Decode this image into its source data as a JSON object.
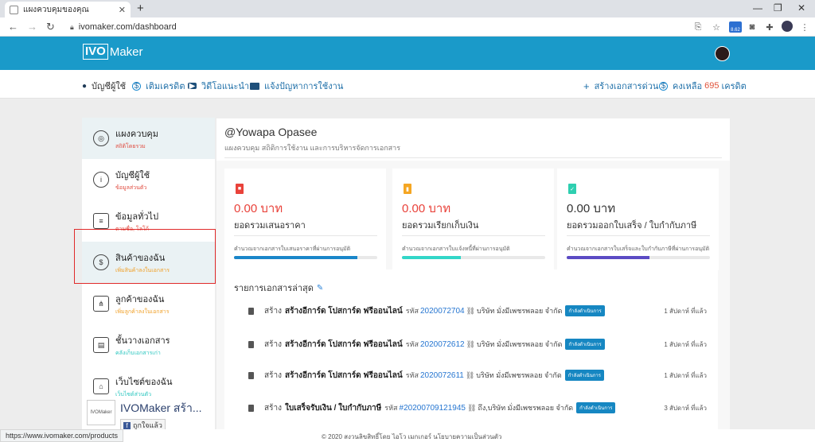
{
  "browser": {
    "tab_title": "แผงควบคุมของคุณ",
    "tab_close": "✕",
    "new_tab": "+",
    "url": "ivomaker.com/dashboard",
    "ext_badge": "8.62",
    "status_url": "https://www.ivomaker.com/products"
  },
  "header": {
    "logo_box": "IVO",
    "logo_text": "Maker"
  },
  "subnav": {
    "account": "บัญชีผู้ใช้",
    "topup": "เติมเครดิต",
    "videos": "วิดีโอแนะนำ",
    "report": "แจ้งปัญหาการใช้งาน",
    "quick_create": "สร้างเอกสารด่วน",
    "credit_prefix": "คงเหลือ",
    "credit_value": "695",
    "credit_suffix": "เครดิต"
  },
  "sidebar": {
    "items": [
      {
        "label": "แผงควบคุม",
        "sub": "สถิติโดยรวม"
      },
      {
        "label": "บัญชีผู้ใช้",
        "sub": "ข้อมูลส่วนตัว"
      },
      {
        "label": "ข้อมูลทั่วไป",
        "sub": "ตามชื่อ, โลโก้"
      },
      {
        "label": "สินค้าของฉัน",
        "sub": "เพิ่มสินค้าลงในเอกสาร"
      },
      {
        "label": "ลูกค้าของฉัน",
        "sub": "เพิ่มลูกค้าลงในเอกสาร"
      },
      {
        "label": "ชั้นวางเอกสาร",
        "sub": "คลังเก็บเอกสารเก่า"
      },
      {
        "label": "เว็บไซต์ของฉัน",
        "sub": "เว็บไซต์ส่วนตัว"
      }
    ],
    "fb_logo": "IVOMaker",
    "fb_title": "IVOMaker สร้า...",
    "fb_like": "ถูกใจแล้ว"
  },
  "main": {
    "username": "@Yowapa Opasee",
    "description": "แผงควบคุม สถิติการใช้งาน และการบริหารจัดการเอกสาร",
    "cards": [
      {
        "amount": "0.00 บาท",
        "label": "ยอดรวมเสนอราคา",
        "note": "คำนวณจากเอกสารใบเสนอราคาที่ผ่านการอนุมัติ",
        "progress": 0.86
      },
      {
        "amount": "0.00 บาท",
        "label": "ยอดรวมเรียกเก็บเงิน",
        "note": "คำนวณจากเอกสารใบแจ้งหนี้ที่ผ่านการอนุมัติ",
        "progress": 0.41
      },
      {
        "amount": "0.00 บาท",
        "label": "ยอดรวมออกใบเสร็จ / ใบกำกับภาษี",
        "note": "คำนวณจากเอกสารใบเสร็จและใบกำกับภาษีที่ผ่านการอนุมัติ",
        "progress": 0.58
      }
    ],
    "recent_title": "รายการเอกสารล่าสุด",
    "recent": [
      {
        "prefix": "สร้าง",
        "title": "สร้างอีการ์ด โปสการ์ด ฟรีออนไลน์",
        "code_label": "รหัส",
        "code": "2020072704",
        "company": "บริษัท มั่งมีเพชรพลอย จำกัด",
        "badge": "กำลังดำเนินการ",
        "time": "1 สัปดาห์ ที่แล้ว"
      },
      {
        "prefix": "สร้าง",
        "title": "สร้างอีการ์ด โปสการ์ด ฟรีออนไลน์",
        "code_label": "รหัส",
        "code": "2020072612",
        "company": "บริษัท มั่งมีเพชรพลอย จำกัด",
        "badge": "กำลังดำเนินการ",
        "time": "1 สัปดาห์ ที่แล้ว"
      },
      {
        "prefix": "สร้าง",
        "title": "สร้างอีการ์ด โปสการ์ด ฟรีออนไลน์",
        "code_label": "รหัส",
        "code": "2020072611",
        "company": "บริษัท มั่งมีเพชรพลอย จำกัด",
        "badge": "กำลังดำเนินการ",
        "time": "1 สัปดาห์ ที่แล้ว"
      },
      {
        "prefix": "สร้าง",
        "title": "ใบเสร็จรับเงิน / ใบกำกับภาษี",
        "code_label": "รหัส",
        "code": "#20200709121945",
        "company": "ถึง,บริษัท มั่งมีเพชรพลอย จำกัด",
        "badge": "กำลังดำเนินการ",
        "time": "3 สัปดาห์ ที่แล้ว"
      }
    ]
  },
  "footer": "© 2020 สงวนลิขสิทธิ์โดย ไอโว เมกเกอร์ นโยบายความเป็นส่วนตัว",
  "colors": {
    "brand": "#1a9ac9",
    "card1": "#e9423a",
    "card2": "#f5a623",
    "card3": "#2ecfb0",
    "bar1": "#1a86c9",
    "bar2": "#32d6c8",
    "bar3": "#5b4bc4",
    "highlight": "#e02a2a"
  }
}
